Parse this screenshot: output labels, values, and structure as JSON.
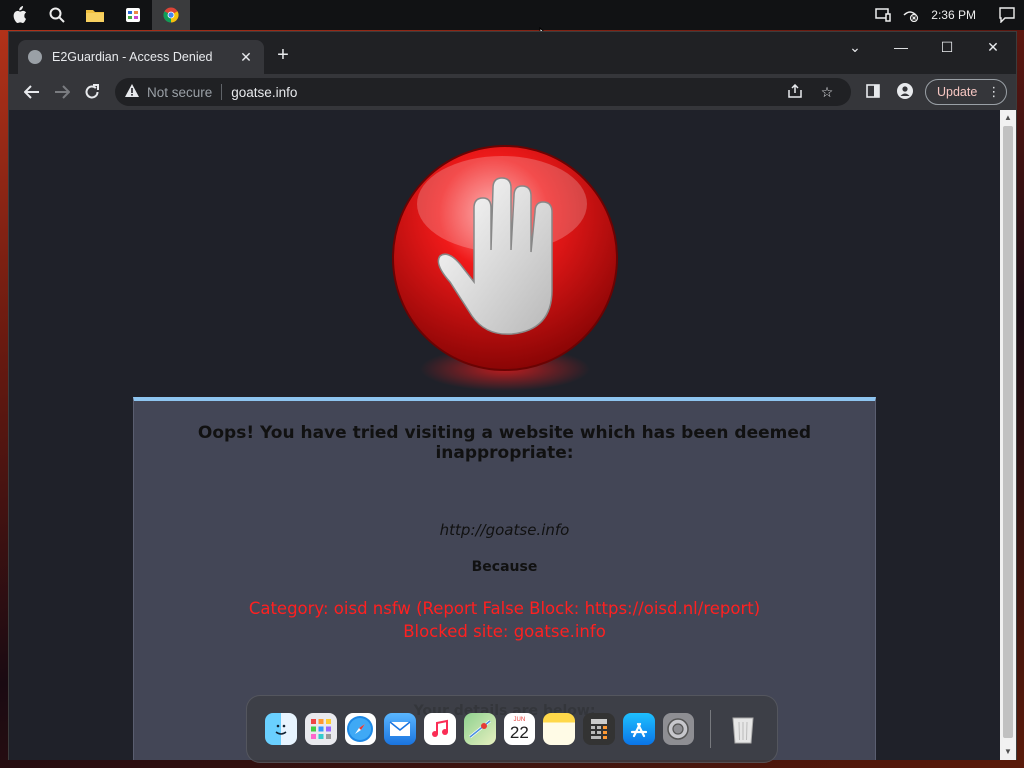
{
  "desktop": {
    "clock": "2:36 PM",
    "taskbar_icons": [
      "apple-icon",
      "search-icon",
      "folder-icon",
      "app-grid-icon",
      "chrome-icon"
    ]
  },
  "browser": {
    "tab_title": "E2Guardian - Access Denied",
    "security_label": "Not secure",
    "url": "goatse.info",
    "update_label": "Update"
  },
  "page": {
    "headline": "Oops! You have tried visiting a website which has been deemed inappropriate:",
    "blocked_url": "http://goatse.info",
    "because_label": "Because",
    "category_line": "Category: oisd nsfw (Report False Block: https://oisd.nl/report)",
    "blocked_site_line": "Blocked site: goatse.info",
    "details_label": "Your details are below:"
  },
  "dock": {
    "calendar_month": "JUN",
    "calendar_day": "22",
    "apps": [
      "finder",
      "launchpad",
      "safari",
      "mail",
      "music",
      "maps",
      "calendar",
      "notes",
      "calculator",
      "app-store",
      "system-settings",
      "trash"
    ]
  },
  "colors": {
    "blocked_text": "#ff2020",
    "box_accent": "#8ec5f0",
    "page_bg": "#1f2129",
    "box_bg": "#434656"
  }
}
